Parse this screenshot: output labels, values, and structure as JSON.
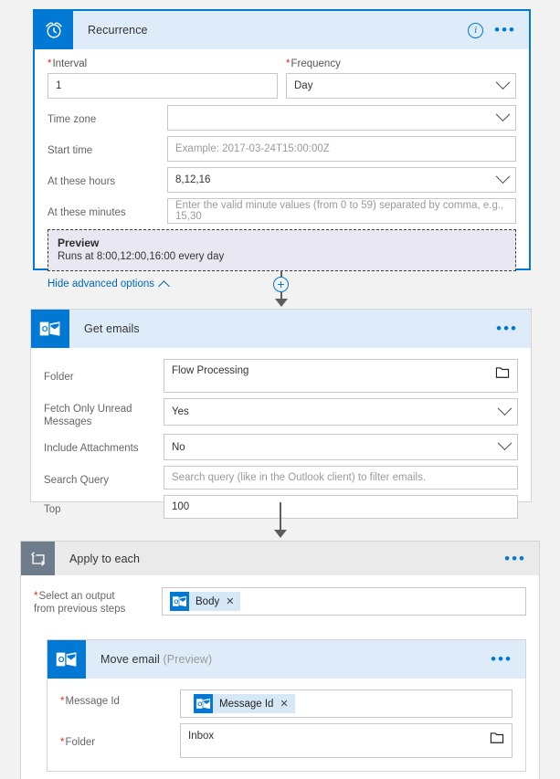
{
  "canvas": {
    "background": "#f2f2f2",
    "accent": "#0078d4",
    "header_bg": "#deecf9"
  },
  "recurrence_card": {
    "title": "Recurrence",
    "icon": "alarm-clock-icon",
    "info_glyph": "i",
    "ellipsis": "•••",
    "interval": {
      "label": "Interval",
      "required": true,
      "value": "1"
    },
    "frequency": {
      "label": "Frequency",
      "required": true,
      "value": "Day"
    },
    "rows": [
      {
        "label": "Time zone",
        "required": false,
        "value": "",
        "placeholder": "",
        "control": "dropdown"
      },
      {
        "label": "Start time",
        "required": false,
        "value": "",
        "placeholder": "Example: 2017-03-24T15:00:00Z",
        "control": "text"
      },
      {
        "label": "At these hours",
        "required": false,
        "value": "8,12,16",
        "placeholder": "",
        "control": "dropdown"
      },
      {
        "label": "At these minutes",
        "required": false,
        "value": "",
        "placeholder": "Enter the valid minute values (from 0 to 59) separated by comma, e.g., 15,30",
        "control": "text"
      }
    ],
    "preview": {
      "title": "Preview",
      "text": "Runs at 8:00,12:00,16:00 every day"
    },
    "advanced_link": "Hide advanced options"
  },
  "connector_1": {
    "plus_glyph": "+"
  },
  "get_emails_card": {
    "title": "Get emails",
    "icon": "outlook-icon",
    "ellipsis": "•••",
    "rows": [
      {
        "label": "Folder",
        "required": false,
        "value": "Flow Processing",
        "placeholder": "",
        "control": "folder",
        "tall": true
      },
      {
        "label": "Fetch Only Unread Messages",
        "required": false,
        "value": "Yes",
        "placeholder": "",
        "control": "dropdown",
        "tall": true
      },
      {
        "label": "Include Attachments",
        "required": false,
        "value": "No",
        "placeholder": "",
        "control": "dropdown",
        "tall": false
      },
      {
        "label": "Search Query",
        "required": false,
        "value": "",
        "placeholder": "Search query (like in the Outlook client) to filter emails.",
        "control": "text",
        "tall": false
      },
      {
        "label": "Top",
        "required": false,
        "value": "100",
        "placeholder": "",
        "control": "text",
        "tall": false
      }
    ]
  },
  "apply_to_each_card": {
    "title": "Apply to each",
    "icon": "loop-icon",
    "ellipsis": "•••",
    "select_output": {
      "label_line1": "Select an output",
      "label_line2": "from previous steps",
      "required": true,
      "token": {
        "label": "Body",
        "icon": "outlook-icon",
        "remove_glyph": "✕"
      }
    },
    "move_email_card": {
      "title": "Move email",
      "preview_suffix": "(Preview)",
      "icon": "outlook-icon",
      "ellipsis": "•••",
      "message_id": {
        "label": "Message Id",
        "required": true,
        "token": {
          "label": "Message Id",
          "icon": "outlook-icon",
          "remove_glyph": "✕"
        }
      },
      "folder": {
        "label": "Folder",
        "required": true,
        "value": "Inbox",
        "control": "folder"
      }
    }
  }
}
